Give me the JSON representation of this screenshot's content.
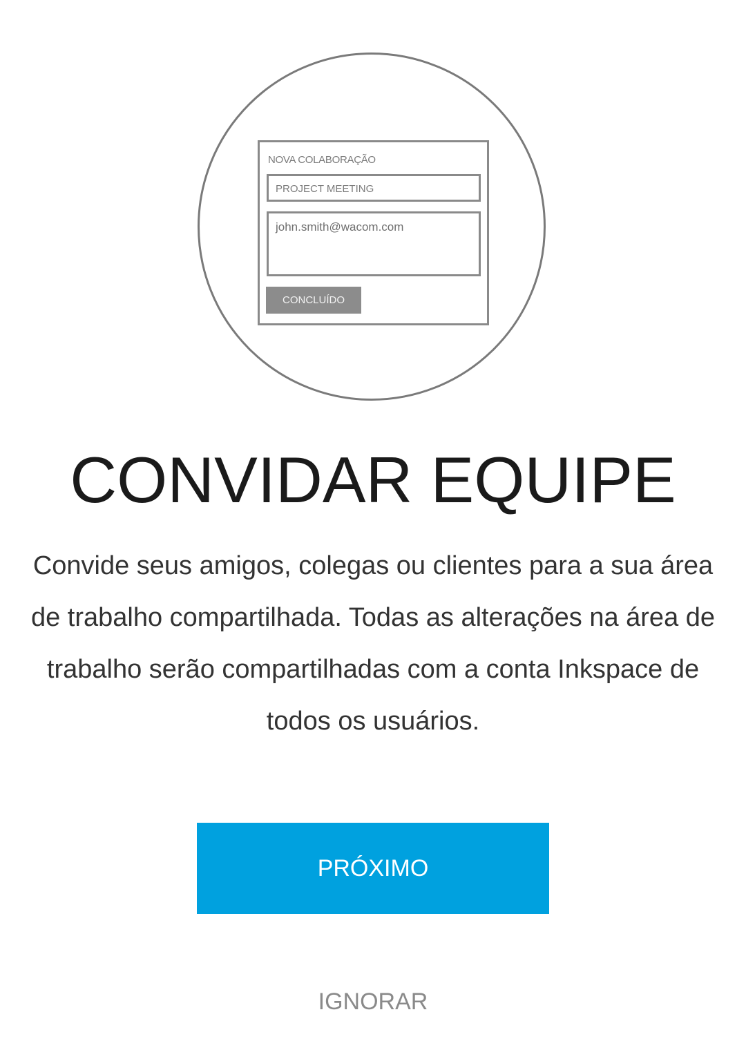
{
  "illustration": {
    "card_title": "NOVA COLABORAÇÃO",
    "subject_field": "PROJECT MEETING",
    "email_field": "john.smith@wacom.com",
    "done_button": "CONCLUÍDO"
  },
  "title": "CONVIDAR EQUIPE",
  "description": "Convide seus amigos, colegas ou clientes para a sua área de trabalho compartilhada. Todas as alterações na área de trabalho serão compartilhadas com a conta Inkspace de todos os usuários.",
  "next_button": "PRÓXIMO",
  "skip_link": "IGNORAR",
  "colors": {
    "accent": "#00a1df",
    "title": "#1a1a1a",
    "body_text": "#333333",
    "muted": "#8a8a8a"
  }
}
